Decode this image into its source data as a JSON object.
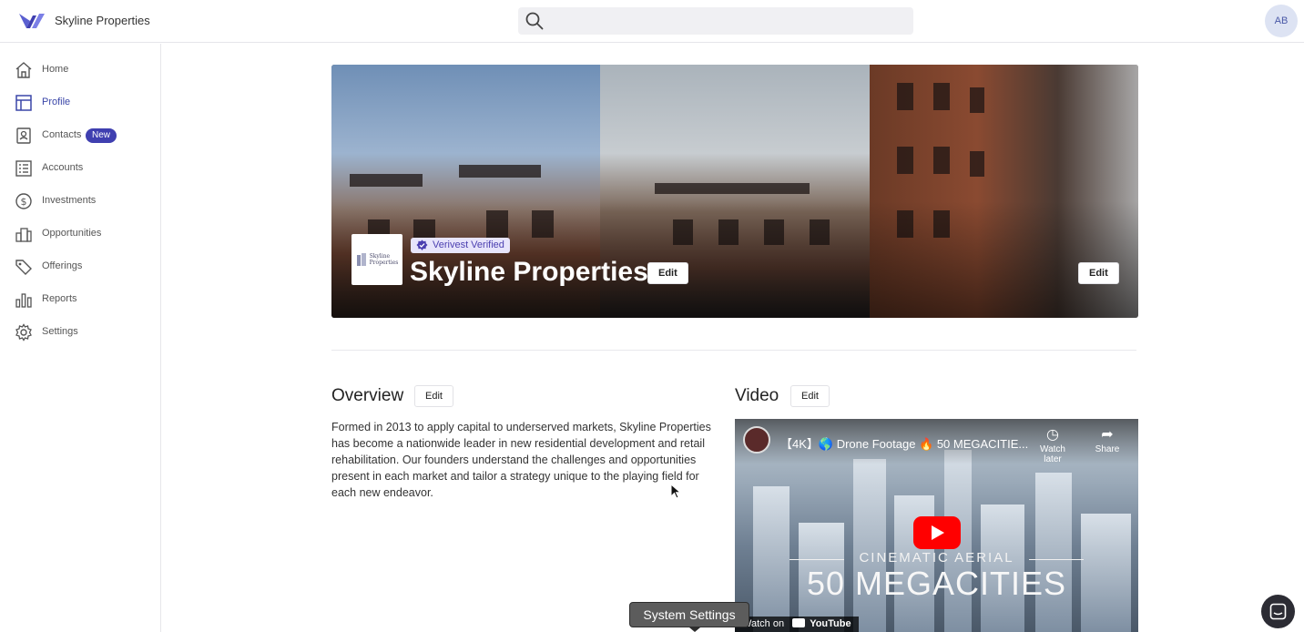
{
  "app": {
    "brand": "Skyline Properties",
    "avatar_initials": "AB",
    "accent": "#3f3fb0",
    "search_placeholder": ""
  },
  "sidebar": {
    "items": [
      {
        "label": "Home",
        "icon": "home-icon"
      },
      {
        "label": "Profile",
        "icon": "profile-icon",
        "active": true
      },
      {
        "label": "Contacts",
        "icon": "contacts-icon",
        "badge": "New"
      },
      {
        "label": "Accounts",
        "icon": "accounts-icon"
      },
      {
        "label": "Investments",
        "icon": "investments-icon"
      },
      {
        "label": "Opportunities",
        "icon": "opportunities-icon"
      },
      {
        "label": "Offerings",
        "icon": "offerings-icon"
      },
      {
        "label": "Reports",
        "icon": "reports-icon"
      },
      {
        "label": "Settings",
        "icon": "settings-icon"
      }
    ]
  },
  "hero": {
    "logo_text_1": "Skyline",
    "logo_text_2": "Properties",
    "verified_label": "Verivest Verified",
    "title": "Skyline Properties",
    "edit_label": "Edit",
    "cover_edit_label": "Edit"
  },
  "overview": {
    "title": "Overview",
    "edit_label": "Edit",
    "text": "Formed in 2013 to apply capital to underserved markets, Skyline Properties has become a nationwide leader in new residential development and retail rehabilitation. Our founders understand the challenges and opportunities present in each market and tailor a strategy unique to the playing field for each new endeavor."
  },
  "video": {
    "title": "Video",
    "edit_label": "Edit",
    "video_title": "【4K】🌎 Drone Footage 🔥 50 MEGACITIE...",
    "watch_later": "Watch later",
    "share": "Share",
    "overlay_sub": "Cinematic Aerial",
    "overlay_title": "50 MEGACITIES",
    "watch_on": "Watch on",
    "youtube": "YouTube"
  },
  "tooltip": {
    "label": "System Settings"
  }
}
